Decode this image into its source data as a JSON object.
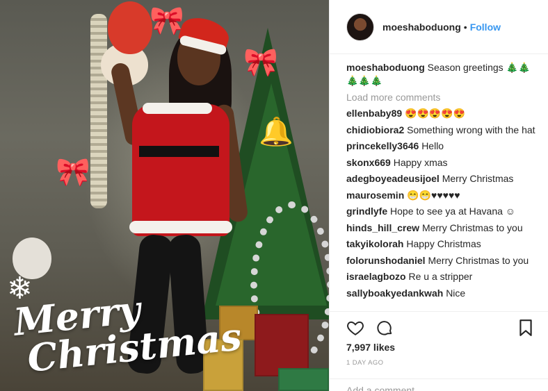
{
  "post": {
    "photo_text": {
      "line1": "Merry",
      "line2": "Christmas"
    }
  },
  "header": {
    "username": "moeshaboduong",
    "separator": "•",
    "follow_label": "Follow"
  },
  "caption": {
    "username": "moeshaboduong",
    "text": "Season greetings 🎄🎄 🎄🎄🎄"
  },
  "load_more_label": "Load more comments",
  "comments": [
    {
      "user": "ellenbaby89",
      "text": "😍😍😍😍😍"
    },
    {
      "user": "chidiobiora2",
      "text": "Something wrong with the hat"
    },
    {
      "user": "princekelly3646",
      "text": "Hello"
    },
    {
      "user": "skonx669",
      "text": "Happy xmas"
    },
    {
      "user": "adegboyeadeusijoel",
      "text": "Merry Christmas"
    },
    {
      "user": "maurosemin",
      "text": "😁😁♥♥♥♥♥"
    },
    {
      "user": "grindlyfe",
      "text": "Hope to see ya at Havana ☺"
    },
    {
      "user": "hinds_hill_crew",
      "text": "Merry Christmas to you"
    },
    {
      "user": "takyikolorah",
      "text": "Happy Christmas"
    },
    {
      "user": "folorunshodaniel",
      "text": "Merry Christmas to you"
    },
    {
      "user": "israelagbozo",
      "text": "Re u a stripper"
    },
    {
      "user": "sallyboakyedankwah",
      "text": "Nice"
    }
  ],
  "actions": {
    "like_icon": "heart-icon",
    "comment_icon": "comment-bubble-icon",
    "save_icon": "bookmark-icon"
  },
  "likes_label": "7,997 likes",
  "age_label": "1 DAY AGO",
  "add_comment_placeholder": "Add a comment…"
}
